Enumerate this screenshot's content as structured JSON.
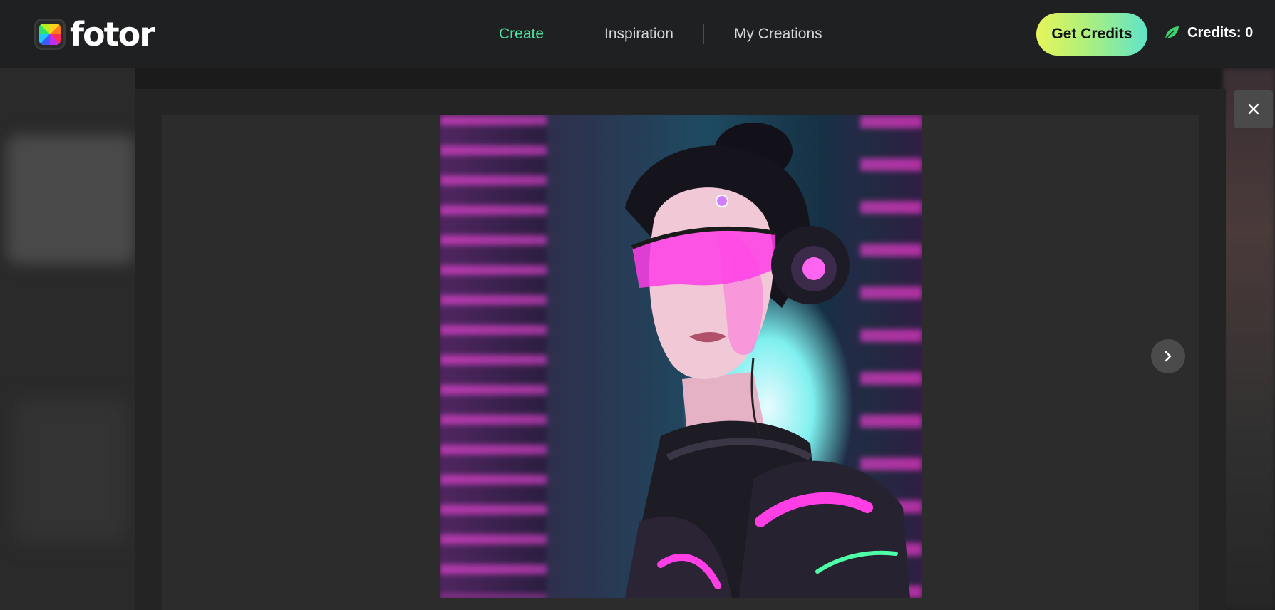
{
  "brand": {
    "name": "fotor",
    "logo_icon": "fotor-color-wheel-logo"
  },
  "nav": {
    "items": [
      {
        "label": "Create",
        "active": true
      },
      {
        "label": "Inspiration",
        "active": false
      },
      {
        "label": "My Creations",
        "active": false
      }
    ]
  },
  "header": {
    "get_credits_label": "Get Credits",
    "credits_text": "Credits: 0",
    "credits_icon": "leaf-icon"
  },
  "viewer": {
    "close_icon": "close-icon",
    "next_icon": "chevron-right-icon",
    "image_subject": "cyberpunk woman with magenta visor and headphones"
  },
  "colors": {
    "accent": "#4ee3a0",
    "button_gradient_start": "#e7f55a",
    "button_gradient_end": "#5fe4c9",
    "neon_magenta": "#ff3ee6",
    "neon_cyan": "#5ff0f0"
  }
}
